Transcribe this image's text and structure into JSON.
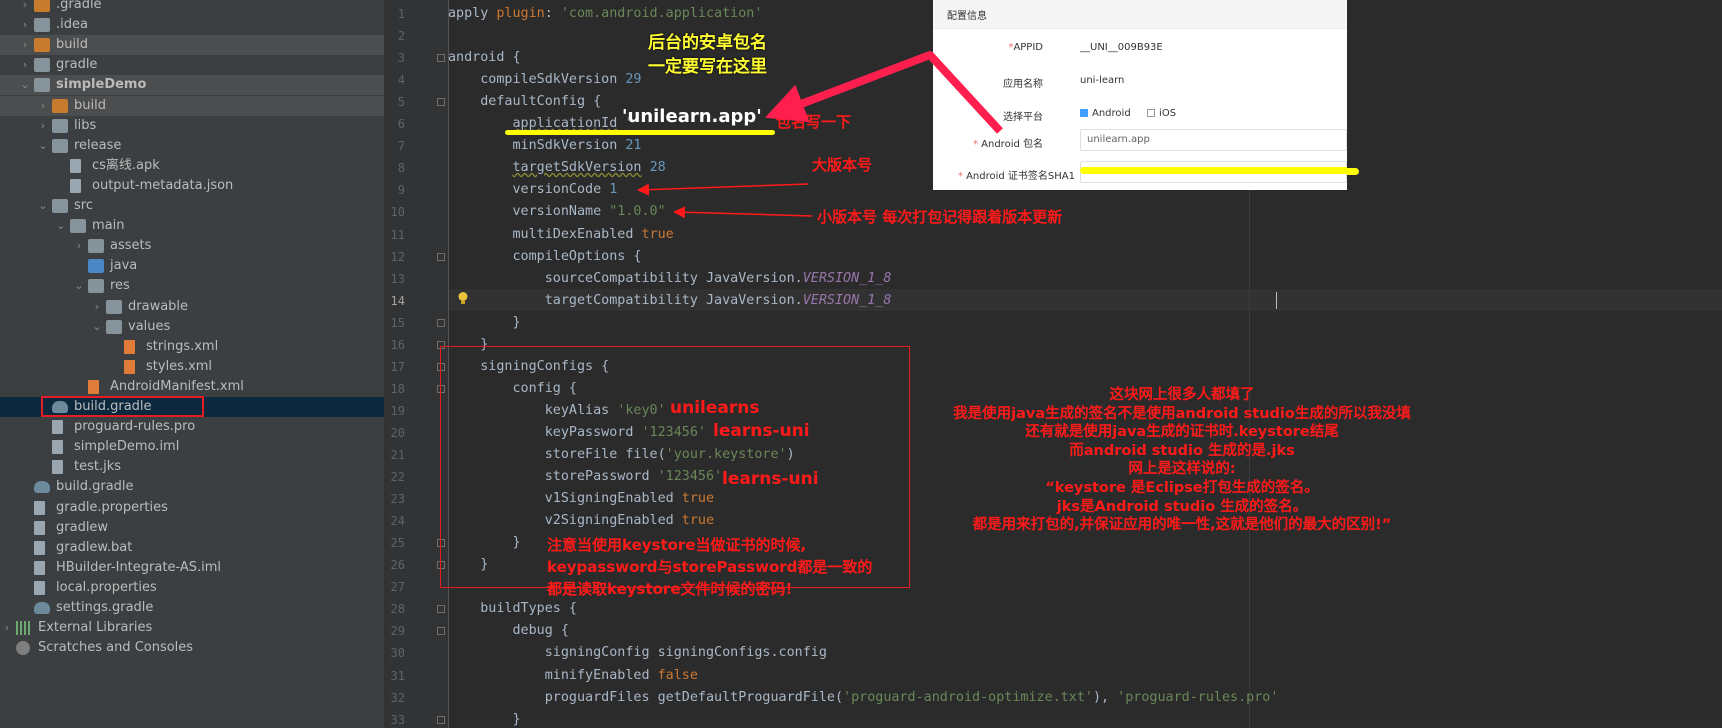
{
  "tree": {
    "items": [
      {
        "label": ".gradle",
        "indent": 1,
        "chev": "›",
        "icon": "folder-orange"
      },
      {
        "label": ".idea",
        "indent": 1,
        "chev": "›",
        "icon": "folder-gray"
      },
      {
        "label": "build",
        "indent": 1,
        "chev": "›",
        "icon": "folder-orange"
      },
      {
        "label": "gradle",
        "indent": 1,
        "chev": "›",
        "icon": "folder-gray"
      },
      {
        "label": "simpleDemo",
        "indent": 1,
        "chev": "⌄",
        "icon": "folder-module",
        "bold": true
      },
      {
        "label": "build",
        "indent": 2,
        "chev": "›",
        "icon": "folder-orange"
      },
      {
        "label": "libs",
        "indent": 2,
        "chev": "›",
        "icon": "folder-gray"
      },
      {
        "label": "release",
        "indent": 2,
        "chev": "⌄",
        "icon": "folder-gray"
      },
      {
        "label": "cs离线.apk",
        "indent": 3,
        "chev": "",
        "icon": "file-apk"
      },
      {
        "label": "output-metadata.json",
        "indent": 3,
        "chev": "",
        "icon": "file"
      },
      {
        "label": "src",
        "indent": 2,
        "chev": "⌄",
        "icon": "folder-gray"
      },
      {
        "label": "main",
        "indent": 3,
        "chev": "⌄",
        "icon": "folder-gray"
      },
      {
        "label": "assets",
        "indent": 4,
        "chev": "›",
        "icon": "folder-gray"
      },
      {
        "label": "java",
        "indent": 4,
        "chev": "",
        "icon": "folder-blue"
      },
      {
        "label": "res",
        "indent": 4,
        "chev": "⌄",
        "icon": "folder-gray"
      },
      {
        "label": "drawable",
        "indent": 5,
        "chev": "›",
        "icon": "folder-gray"
      },
      {
        "label": "values",
        "indent": 5,
        "chev": "⌄",
        "icon": "folder-gray"
      },
      {
        "label": "strings.xml",
        "indent": 6,
        "chev": "",
        "icon": "file-xml"
      },
      {
        "label": "styles.xml",
        "indent": 6,
        "chev": "",
        "icon": "file-xml"
      },
      {
        "label": "AndroidManifest.xml",
        "indent": 4,
        "chev": "",
        "icon": "file-xml"
      },
      {
        "label": "build.gradle",
        "indent": 2,
        "chev": "",
        "icon": "file-gradle",
        "selected": true
      },
      {
        "label": "proguard-rules.pro",
        "indent": 2,
        "chev": "",
        "icon": "file"
      },
      {
        "label": "simpleDemo.iml",
        "indent": 2,
        "chev": "",
        "icon": "file"
      },
      {
        "label": "test.jks",
        "indent": 2,
        "chev": "",
        "icon": "file"
      },
      {
        "label": "build.gradle",
        "indent": 1,
        "chev": "",
        "icon": "file-gradle"
      },
      {
        "label": "gradle.properties",
        "indent": 1,
        "chev": "",
        "icon": "file"
      },
      {
        "label": "gradlew",
        "indent": 1,
        "chev": "",
        "icon": "file"
      },
      {
        "label": "gradlew.bat",
        "indent": 1,
        "chev": "",
        "icon": "file"
      },
      {
        "label": "HBuilder-Integrate-AS.iml",
        "indent": 1,
        "chev": "",
        "icon": "file"
      },
      {
        "label": "local.properties",
        "indent": 1,
        "chev": "",
        "icon": "file"
      },
      {
        "label": "settings.gradle",
        "indent": 1,
        "chev": "",
        "icon": "file-gradle"
      },
      {
        "label": "External Libraries",
        "indent": 0,
        "chev": "›",
        "icon": "lib"
      },
      {
        "label": "Scratches and Consoles",
        "indent": 0,
        "chev": "",
        "icon": "scratch"
      }
    ]
  },
  "editor": {
    "current_line": 14,
    "lines": [
      {
        "n": "1",
        "html": "apply <span class='k'>plugin</span>: <span class='s'>'com.android.application'</span>"
      },
      {
        "n": "2",
        "html": ""
      },
      {
        "n": "3",
        "html": "android {"
      },
      {
        "n": "4",
        "html": "    compileSdkVersion <span class='n'>29</span>"
      },
      {
        "n": "5",
        "html": "    defaultConfig {"
      },
      {
        "n": "6",
        "html": "        <span class='u'>applicationId</span> <span class='s'>&quot;</span>"
      },
      {
        "n": "7",
        "html": "        minSdkVersion <span class='n'>21</span>"
      },
      {
        "n": "8",
        "html": "        <span class='u'>targetSdkVersion</span> <span class='n'>28</span>"
      },
      {
        "n": "9",
        "html": "        versionCode <span class='n'>1</span>"
      },
      {
        "n": "10",
        "html": "        versionName <span class='s'>\"1.0.0\"</span>"
      },
      {
        "n": "11",
        "html": "        multiDexEnabled <span class='k'>true</span>"
      },
      {
        "n": "12",
        "html": "        compileOptions {"
      },
      {
        "n": "13",
        "html": "            sourceCompatibility JavaVersion.<span class='i'>VERSION_1_8</span>"
      },
      {
        "n": "14",
        "html": "            targetCompatibility JavaVersion.<span class='i'>VERSION_1_8</span>"
      },
      {
        "n": "15",
        "html": "        }"
      },
      {
        "n": "16",
        "html": "    }"
      },
      {
        "n": "17",
        "html": "    signingConfigs {"
      },
      {
        "n": "18",
        "html": "        config {"
      },
      {
        "n": "19",
        "html": "            keyAlias <span class='s'>'key0'</span>"
      },
      {
        "n": "20",
        "html": "            keyPassword <span class='s'>'123456'</span>"
      },
      {
        "n": "21",
        "html": "            storeFile file(<span class='s'>'your.keystore'</span>)"
      },
      {
        "n": "22",
        "html": "            storePassword <span class='s'>'123456'</span>"
      },
      {
        "n": "23",
        "html": "            v1SigningEnabled <span class='k'>true</span>"
      },
      {
        "n": "24",
        "html": "            v2SigningEnabled <span class='k'>true</span>"
      },
      {
        "n": "25",
        "html": "        }"
      },
      {
        "n": "26",
        "html": "    }"
      },
      {
        "n": "27",
        "html": ""
      },
      {
        "n": "28",
        "html": "    buildTypes {"
      },
      {
        "n": "29",
        "html": "        debug {"
      },
      {
        "n": "30",
        "html": "            signingConfig signingConfigs.config"
      },
      {
        "n": "31",
        "html": "            minifyEnabled <span class='k'>false</span>"
      },
      {
        "n": "32",
        "html": "            proguardFiles getDefaultProguardFile(<span class='s'>'proguard-android-optimize.txt'</span>), <span class='s'>'proguard-rules.pro'</span>"
      },
      {
        "n": "33",
        "html": "        }"
      }
    ],
    "folds": [
      3,
      5,
      12,
      15,
      16,
      17,
      18,
      25,
      26,
      28,
      29,
      33
    ]
  },
  "annotations": {
    "package_hint_1": "后台的安卓包名",
    "package_hint_2": "一定要写在这里",
    "package_value": "'unilearn.app'",
    "package_note": "包名写一下",
    "major_version": "大版本号",
    "minor_version": "小版本号 每次打包记得跟着版本更新",
    "alias_value": "unilearns",
    "key_password_value": "learns-uni",
    "store_password_value": "learns-uni",
    "keystore_note_1": "注意当使用keystore当做证书的时候,",
    "keystore_note_2": "keypassword与storePassword都是一致的",
    "keystore_note_3": "都是读取keystore文件时候的密码!",
    "right_note": [
      "这块网上很多人都填了",
      "我是使用java生成的签名不是使用android studio生成的所以我没填",
      "还有就是使用java生成的证书时.keystore结尾",
      "而android studio 生成的是.jks",
      "网上是这样说的:",
      "“keystore 是Eclipse打包生成的签名。",
      "jks是Android studio 生成的签名。",
      "都是用来打包的,并保证应用的唯一性,这就是他们的最大的区别!”"
    ]
  },
  "config_panel": {
    "header": "配置信息",
    "appid_label": "APPID",
    "appid_value": "__UNI__009B93E",
    "app_name_label": "应用名称",
    "app_name_value": "uni-learn",
    "platform_label": "选择平台",
    "platform_android": "Android",
    "platform_ios": "iOS",
    "package_label": "Android 包名",
    "package_value": "unilearn.app",
    "sha1_label": "Android 证书签名SHA1"
  },
  "colors": {
    "annotation_red": "#ff1a1a",
    "annotation_yellow": "#ffff33",
    "highlight_yellow": "#ffff00"
  }
}
